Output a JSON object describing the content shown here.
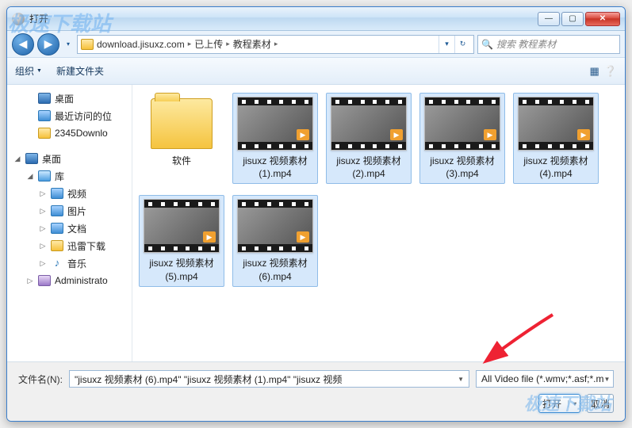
{
  "window": {
    "title": "打开"
  },
  "win_controls": {
    "min": "—",
    "max": "▢",
    "close": "✕"
  },
  "nav": {
    "back": "◀",
    "fwd": "▶",
    "drop": "▾",
    "crumbs": [
      "download.jisuxz.com",
      "已上传",
      "教程素材"
    ],
    "crumb_tail": "▸",
    "refresh": "↻",
    "dd": "▾"
  },
  "search": {
    "placeholder": "搜索 教程素材",
    "icon": "🔍"
  },
  "toolbar": {
    "organize": "组织",
    "newfolder": "新建文件夹",
    "view_icons": "▦",
    "view_help": "❔"
  },
  "sidebar": {
    "desktop1": "桌面",
    "recent": "最近访问的位",
    "dl2345": "2345Downlo",
    "desktop2": "桌面",
    "library": "库",
    "video": "视频",
    "picture": "图片",
    "document": "文档",
    "xunlei": "迅雷下载",
    "music_icon": "♪",
    "music": "音乐",
    "admin": "Administrato"
  },
  "files": {
    "folder": "软件",
    "v1": "jisuxz 视频素材 (1).mp4",
    "v2": "jisuxz 视频素材 (2).mp4",
    "v3": "jisuxz 视频素材 (3).mp4",
    "v4": "jisuxz 视频素材 (4).mp4",
    "v5": "jisuxz 视频素材 (5).mp4",
    "v6": "jisuxz 视频素材 (6).mp4"
  },
  "footer": {
    "fname_label": "文件名(N):",
    "fname_value": "\"jisuxz 视频素材 (6).mp4\" \"jisuxz 视频素材 (1).mp4\" \"jisuxz 视频",
    "ftype": "All Video file (*.wmv;*.asf;*.m",
    "open": "打开",
    "open_drop": "▾",
    "cancel": "取消"
  },
  "watermark": {
    "top": "极速下载站",
    "bottom": "极速下载站"
  }
}
